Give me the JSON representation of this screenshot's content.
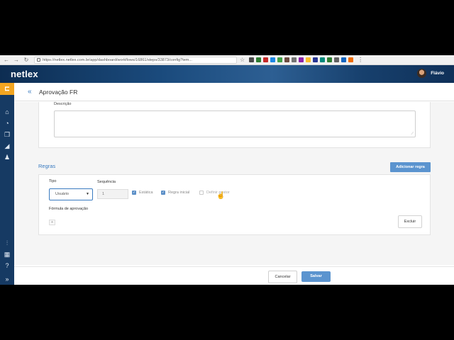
{
  "browser": {
    "url": "https://netlex.netlex.com.br/app/dashboard/workflows/16861/steps/33873/config?tem...",
    "extension_colors": [
      "#4a4a4a",
      "#2e7d32",
      "#c62828",
      "#1e88e5",
      "#43a047",
      "#6d4c41",
      "#757575",
      "#8e24aa",
      "#fbc02d",
      "#283593",
      "#00897b",
      "#2e7d32",
      "#616161",
      "#1565c0",
      "#ef6c00"
    ]
  },
  "header": {
    "logo": "netlex",
    "user_name": "Flávio"
  },
  "page": {
    "title": "Aprovação FR"
  },
  "description": {
    "label": "Descrição",
    "value": ""
  },
  "rules": {
    "section_title": "Regras",
    "add_button": "Adicionar regra",
    "tipo_label": "Tipo",
    "tipo_value": "Usuário",
    "sequencia_label": "Sequência",
    "sequencia_value": "1",
    "estatica_label": "Estática",
    "estatica_checked": true,
    "regra_inicial_label": "Regra inicial",
    "regra_inicial_checked": true,
    "definir_gestor_label": "Definir gestor",
    "definir_gestor_checked": false,
    "formula_label": "Fórmula de aprovação",
    "add_formula": "+",
    "delete_button": "Excluir"
  },
  "footer": {
    "cancel_label": "Cancelar",
    "save_label": "Salvar"
  },
  "colors": {
    "accent": "#5b94cf",
    "sidebar": "#163a63",
    "sidebar_active": "#f2a521",
    "link": "#3a7bc0"
  }
}
